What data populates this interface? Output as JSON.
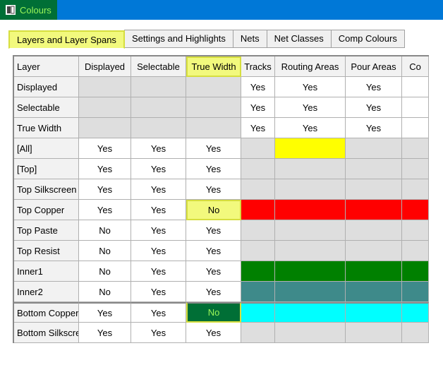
{
  "window": {
    "title": "Colours"
  },
  "tabs": {
    "t0": "Layers and Layer Spans",
    "t1": "Settings and Highlights",
    "t2": "Nets",
    "t3": "Net Classes",
    "t4": "Comp Colours"
  },
  "grid": {
    "headers": {
      "layer": "Layer",
      "displayed": "Displayed",
      "selectable": "Selectable",
      "truewidth": "True Width",
      "tracks": "Tracks",
      "routing": "Routing Areas",
      "pour": "Pour Areas",
      "co": "Co"
    },
    "rows": [
      {
        "name": "Displayed",
        "disp": "",
        "sel": "",
        "tw": "",
        "tracks": "Yes",
        "routing": "Yes",
        "pour": "Yes",
        "colors": null
      },
      {
        "name": "Selectable",
        "disp": "",
        "sel": "",
        "tw": "",
        "tracks": "Yes",
        "routing": "Yes",
        "pour": "Yes",
        "colors": null
      },
      {
        "name": "True Width",
        "disp": "",
        "sel": "",
        "tw": "",
        "tracks": "Yes",
        "routing": "Yes",
        "pour": "Yes",
        "colors": null
      },
      {
        "name": "[All]",
        "disp": "Yes",
        "sel": "Yes",
        "tw": "Yes",
        "colors": {
          "tracks": "c-gray",
          "routing": "c-yellow",
          "pour": "c-gray",
          "co": "c-gray"
        }
      },
      {
        "name": "[Top]",
        "disp": "Yes",
        "sel": "Yes",
        "tw": "Yes",
        "colors": {
          "tracks": "c-gray",
          "routing": "c-gray",
          "pour": "c-gray",
          "co": "c-gray"
        }
      },
      {
        "name": "Top Silkscreen",
        "disp": "Yes",
        "sel": "Yes",
        "tw": "Yes",
        "colors": {
          "tracks": "c-gray",
          "routing": "c-gray",
          "pour": "c-gray",
          "co": "c-gray"
        }
      },
      {
        "name": "Top Copper",
        "disp": "Yes",
        "sel": "Yes",
        "tw": "No",
        "twHl": "yellow",
        "colors": {
          "tracks": "c-red",
          "routing": "c-red",
          "pour": "c-red",
          "co": "c-red"
        }
      },
      {
        "name": "Top Paste",
        "disp": "No",
        "sel": "Yes",
        "tw": "Yes",
        "colors": {
          "tracks": "c-gray",
          "routing": "c-gray",
          "pour": "c-gray",
          "co": "c-gray"
        }
      },
      {
        "name": "Top Resist",
        "disp": "No",
        "sel": "Yes",
        "tw": "Yes",
        "colors": {
          "tracks": "c-gray",
          "routing": "c-gray",
          "pour": "c-gray",
          "co": "c-gray"
        }
      },
      {
        "name": "Inner1",
        "disp": "No",
        "sel": "Yes",
        "tw": "Yes",
        "colors": {
          "tracks": "c-green",
          "routing": "c-green",
          "pour": "c-green",
          "co": "c-green"
        }
      },
      {
        "name": "Inner2",
        "disp": "No",
        "sel": "Yes",
        "tw": "Yes",
        "colors": {
          "tracks": "c-teal",
          "routing": "c-teal",
          "pour": "c-teal",
          "co": "c-teal"
        }
      },
      {
        "name": "Bottom Copper",
        "disp": "Yes",
        "sel": "Yes",
        "tw": "No",
        "twHl": "green",
        "sep": true,
        "colors": {
          "tracks": "c-cyan",
          "routing": "c-cyan",
          "pour": "c-cyan",
          "co": "c-cyan"
        }
      },
      {
        "name": "Bottom Silkscreen",
        "disp": "Yes",
        "sel": "Yes",
        "tw": "Yes",
        "colors": {
          "tracks": "c-gray",
          "routing": "c-gray",
          "pour": "c-gray",
          "co": "c-gray"
        }
      }
    ]
  }
}
